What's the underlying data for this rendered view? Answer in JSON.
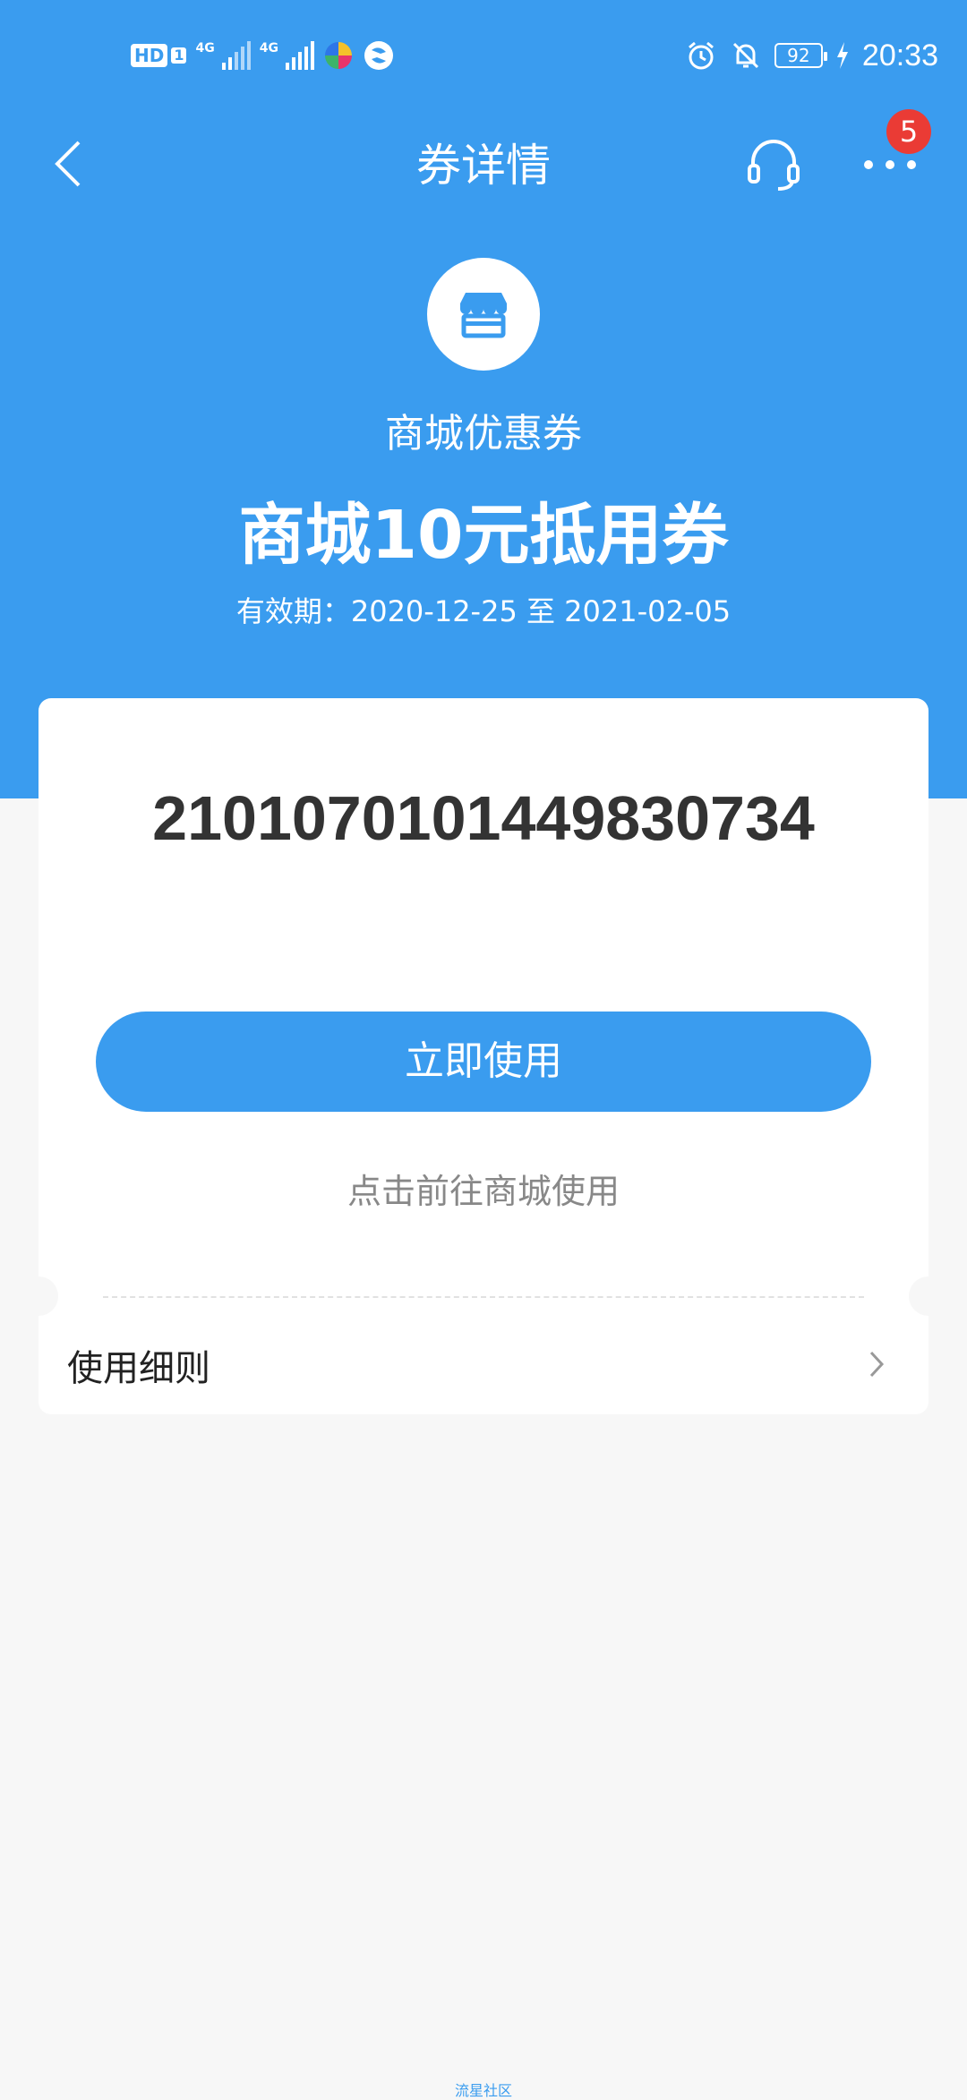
{
  "status_bar": {
    "hd_label": "HD",
    "sim_number": "1",
    "net1_label": "4G",
    "net2_label": "4G",
    "battery_level": "92",
    "time": "20:33"
  },
  "nav": {
    "title": "券详情",
    "notification_count": "5"
  },
  "coupon": {
    "type_label": "商城优惠券",
    "name": "商城10元抵用券",
    "validity": "有效期：2020-12-25 至 2021-02-05",
    "code": "2101070101449830734",
    "use_button_label": "立即使用",
    "hint": "点击前往商城使用",
    "rules_label": "使用细则"
  },
  "watermark": "流星社区",
  "colors": {
    "brand_blue": "#3a9cef",
    "badge_red": "#ea3b35",
    "page_bg": "#f7f7f7"
  }
}
